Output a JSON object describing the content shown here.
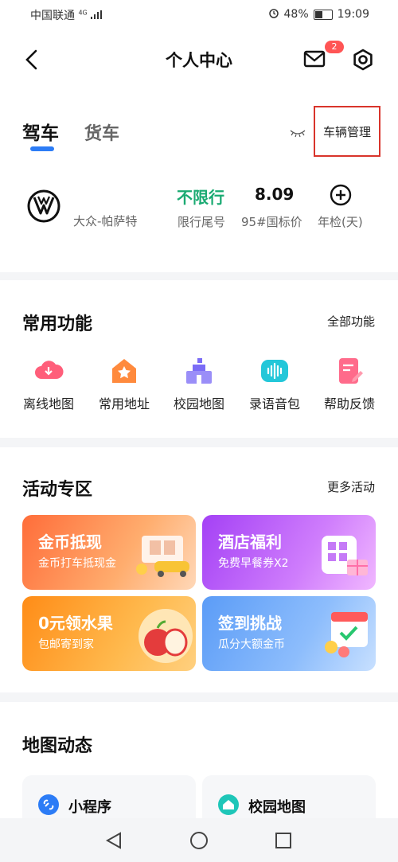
{
  "status_bar": {
    "carrier": "中国联通",
    "network": "4G",
    "battery": "48%",
    "time": "19:09"
  },
  "header": {
    "title": "个人中心",
    "message_badge": "2"
  },
  "vehicle": {
    "tabs": [
      "驾车",
      "货车"
    ],
    "manage_label": "车辆管理",
    "car_name": "大众-帕萨特",
    "restriction_value": "不限行",
    "restriction_label": "限行尾号",
    "fuel_price": "8.09",
    "fuel_label": "95#国标价",
    "inspection_label": "年检(天)"
  },
  "functions": {
    "title": "常用功能",
    "more": "全部功能",
    "items": [
      {
        "label": "离线地图",
        "icon": "cloud-download-icon",
        "color": "#ff5e7a"
      },
      {
        "label": "常用地址",
        "icon": "home-star-icon",
        "color": "#ff8a3d"
      },
      {
        "label": "校园地图",
        "icon": "school-icon",
        "color": "#7b6cf6"
      },
      {
        "label": "录语音包",
        "icon": "voice-wave-icon",
        "color": "#23c7d9"
      },
      {
        "label": "帮助反馈",
        "icon": "feedback-icon",
        "color": "#ff6b8b"
      }
    ]
  },
  "activities": {
    "title": "活动专区",
    "more": "更多活动",
    "cards": [
      {
        "title": "金币抵现",
        "subtitle": "金币打车抵现金"
      },
      {
        "title": "酒店福利",
        "subtitle": "免费早餐券X2"
      },
      {
        "title": "0元领水果",
        "subtitle": "包邮寄到家"
      },
      {
        "title": "签到挑战",
        "subtitle": "瓜分大额金币"
      }
    ]
  },
  "map_dynamics": {
    "title": "地图动态",
    "items": [
      {
        "label": "小程序",
        "icon": "link-icon",
        "color": "#2c7cf6"
      },
      {
        "label": "校园地图",
        "icon": "school-house-icon",
        "color": "#1ec6b8"
      }
    ]
  }
}
